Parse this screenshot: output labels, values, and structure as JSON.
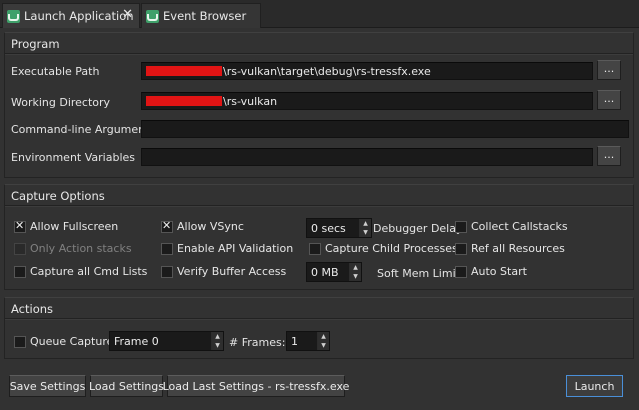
{
  "tabs": [
    {
      "label": "Launch Application",
      "close": "✕"
    },
    {
      "label": "Event Browser",
      "close": "✕"
    }
  ],
  "program": {
    "title": "Program",
    "executable_label": "Executable Path",
    "executable_value": "\\rs-vulkan\\target\\debug\\rs-tressfx.exe",
    "working_dir_label": "Working Directory",
    "working_dir_value": "\\rs-vulkan",
    "args_label": "Command-line Arguments",
    "args_value": "",
    "env_label": "Environment Variables",
    "env_value": "",
    "browse_label": "..."
  },
  "capture": {
    "title": "Capture Options",
    "allow_fullscreen": "Allow Fullscreen",
    "allow_vsync": "Allow VSync",
    "debugger_delay_value": "0 secs",
    "debugger_delay_label": "Debugger Delay",
    "collect_callstacks": "Collect Callstacks",
    "only_action_stacks": "Only Action stacks",
    "enable_api_validation": "Enable API Validation",
    "capture_child_processes": "Capture Child Processes",
    "ref_all_resources": "Ref all Resources",
    "capture_all_cmd_lists": "Capture all Cmd Lists",
    "verify_buffer_access": "Verify Buffer Access",
    "soft_mem_value": "0 MB",
    "soft_mem_label": "Soft Mem Limit",
    "auto_start": "Auto Start"
  },
  "actions": {
    "title": "Actions",
    "queue_capture": "Queue Capture",
    "frame_value": "Frame 0",
    "frames_label": "# Frames:",
    "frames_value": "1"
  },
  "footer": {
    "save_settings": "Save Settings",
    "load_settings": "Load Settings",
    "load_last_settings": "Load Last Settings - rs-tressfx.exe",
    "launch": "Launch"
  },
  "spin_up": "▲",
  "spin_down": "▼"
}
